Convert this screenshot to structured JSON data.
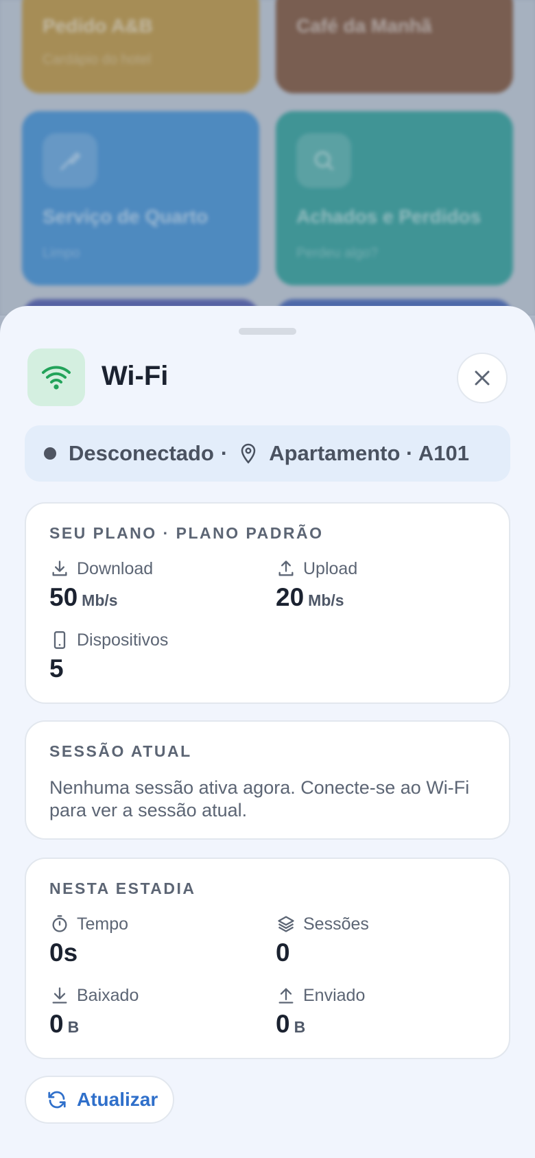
{
  "background": {
    "tiles": [
      {
        "title": "Pedido A&B",
        "subtitle": "Cardápio do hotel"
      },
      {
        "title": "Café da Manhã",
        "subtitle": ""
      },
      {
        "title": "Serviço de Quarto",
        "subtitle": "Limpo"
      },
      {
        "title": "Achados e Perdidos",
        "subtitle": "Perdeu algo?"
      }
    ]
  },
  "sheet": {
    "title": "Wi-Fi",
    "icon": "wifi-icon",
    "accent_color": "#22a35a",
    "status": {
      "connection": "Desconectado",
      "separator": "·",
      "location": "Apartamento · A101"
    },
    "plan": {
      "label": "SEU PLANO · PLANO PADRÃO",
      "download": {
        "label": "Download",
        "value": "50",
        "unit": "Mb/s",
        "icon": "download-icon"
      },
      "upload": {
        "label": "Upload",
        "value": "20",
        "unit": "Mb/s",
        "icon": "upload-icon"
      },
      "devices": {
        "label": "Dispositivos",
        "value": "5",
        "icon": "phone-icon"
      }
    },
    "session": {
      "label": "SESSÃO ATUAL",
      "text": "Nenhuma sessão ativa agora. Conecte-se ao Wi-Fi para ver a sessão atual."
    },
    "stay": {
      "label": "NESTA ESTADIA",
      "time": {
        "label": "Tempo",
        "value": "0s",
        "icon": "timer-icon"
      },
      "sessions": {
        "label": "Sessões",
        "value": "0",
        "icon": "layers-icon"
      },
      "downloaded": {
        "label": "Baixado",
        "value": "0",
        "unit": "B",
        "icon": "download-icon"
      },
      "uploaded": {
        "label": "Enviado",
        "value": "0",
        "unit": "B",
        "icon": "upload-icon"
      }
    },
    "refresh_label": "Atualizar",
    "link_color": "#2f6fca"
  }
}
